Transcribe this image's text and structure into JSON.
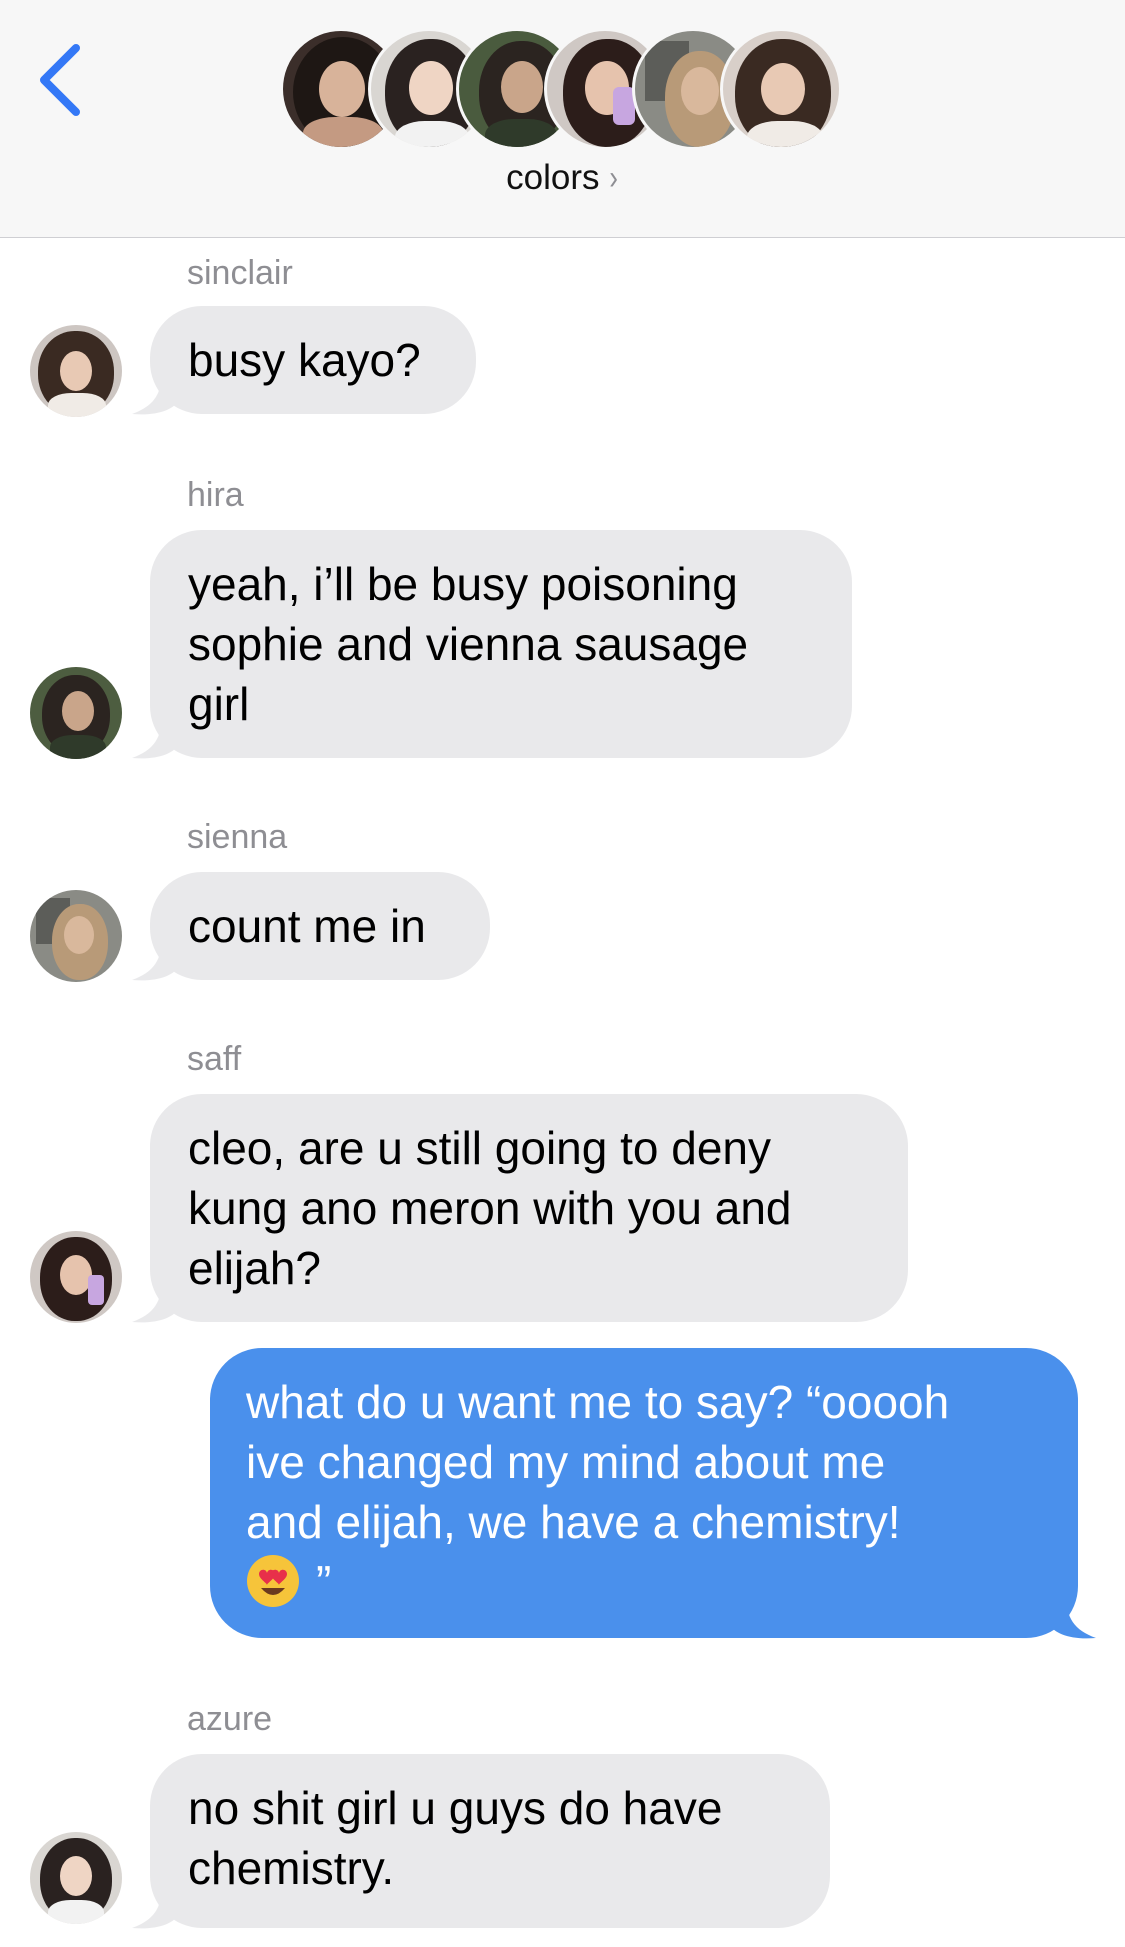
{
  "header": {
    "group_name": "colors",
    "chevron": "›",
    "back_icon": "chevron-left-icon",
    "accent_color": "#3478f6"
  },
  "messages": [
    {
      "sender": "sinclair",
      "direction": "incoming",
      "lines": [
        "busy kayo?"
      ]
    },
    {
      "sender": "hira",
      "direction": "incoming",
      "lines": [
        "yeah, i’ll be busy poisoning",
        "sophie and vienna sausage",
        "girl"
      ]
    },
    {
      "sender": "sienna",
      "direction": "incoming",
      "lines": [
        "count me in"
      ]
    },
    {
      "sender": "saff",
      "direction": "incoming",
      "lines": [
        "cleo, are u still going to deny",
        "kung ano meron with you and",
        "elijah?"
      ]
    },
    {
      "sender": "",
      "direction": "outgoing",
      "lines": [
        "what do u want me to say? “ooooh",
        "ive changed my mind about me",
        "and elijah, we have a chemistry!"
      ],
      "last_line_suffix": "”",
      "emoji": "heart-eyes-emoji"
    },
    {
      "sender": "azure",
      "direction": "incoming",
      "lines": [
        "no shit girl u guys do have",
        "chemistry."
      ]
    }
  ],
  "colors": {
    "incoming_bubble": "#e9e9eb",
    "outgoing_bubble": "#4a90ec",
    "sender_label": "#8e8e93"
  }
}
